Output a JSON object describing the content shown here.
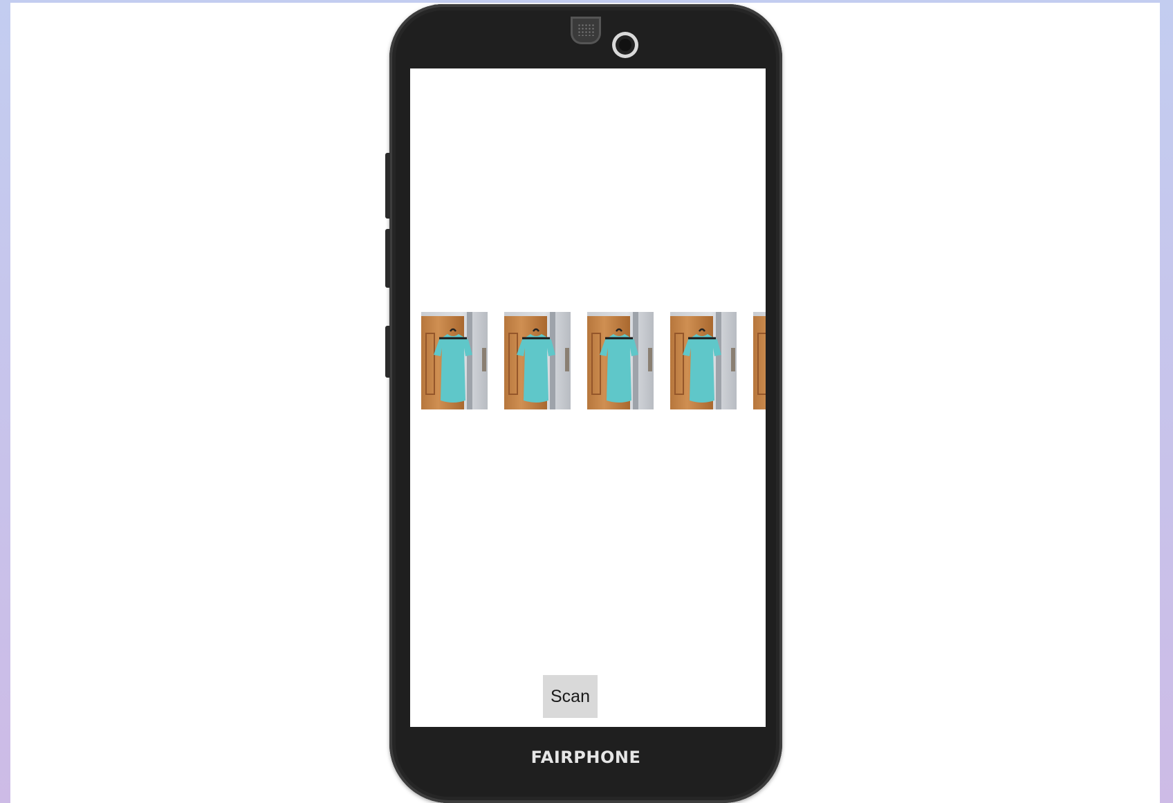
{
  "device": {
    "brand_label": "FAIRPHONE"
  },
  "screen": {
    "gallery": {
      "items": [
        {
          "image": "teal-tshirt-on-hanger-photo"
        },
        {
          "image": "teal-tshirt-on-hanger-photo"
        },
        {
          "image": "teal-tshirt-on-hanger-photo"
        },
        {
          "image": "teal-tshirt-on-hanger-photo"
        },
        {
          "image": "teal-tshirt-on-hanger-photo"
        }
      ]
    },
    "scan_button_label": "Scan"
  },
  "colors": {
    "shirt": "#5fc7c9",
    "phone_body": "#1f1f1f",
    "button_bg": "#d9d9d9"
  }
}
